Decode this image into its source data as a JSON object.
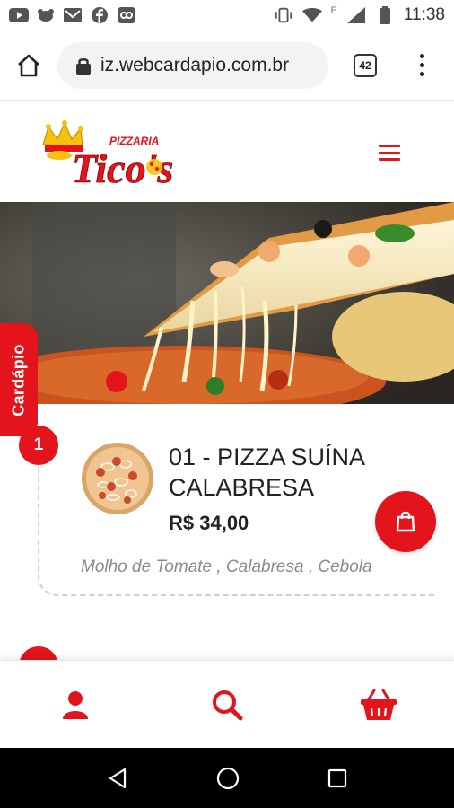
{
  "status_bar": {
    "time": "11:38",
    "network_label": "E",
    "left_icons": [
      "youtube-icon",
      "notification-icon",
      "gmail-icon",
      "facebook-icon",
      "app-icon"
    ],
    "right_icons": [
      "vibrate-icon",
      "wifi-icon",
      "signal-icon",
      "battery-icon"
    ]
  },
  "browser": {
    "url": "iz.webcardapio.com.br",
    "tab_count": "42"
  },
  "site": {
    "logo_small_text": "PIZZARIA",
    "logo_text": "Tico's",
    "side_tab_label": "Cardápio"
  },
  "product": {
    "badge_number": "1",
    "title": "01 - PIZZA SUÍNA CALABRESA",
    "price": "R$ 34,00",
    "description": "Molho de Tomate , Calabresa , Cebola"
  },
  "colors": {
    "brand_red": "#e3141b",
    "logo_yellow": "#f7c20a"
  },
  "bottom_nav": [
    "user-icon",
    "search-icon",
    "basket-icon"
  ],
  "system_nav": [
    "back-icon",
    "home-icon",
    "recents-icon"
  ]
}
